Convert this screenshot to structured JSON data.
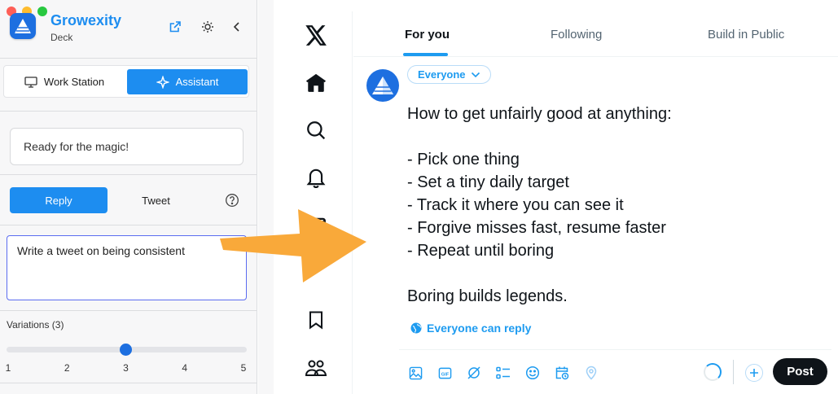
{
  "colors": {
    "brand_blue": "#1d8df0",
    "x_blue": "#1d9bf0",
    "arrow_orange": "#f9a93a",
    "post_button": "#0f1419"
  },
  "extension": {
    "app_name": "Growexity",
    "app_subtitle": "Deck",
    "header_icons": [
      "external-link-icon",
      "sun-icon",
      "chevron-left-icon"
    ],
    "mode_tabs": [
      {
        "label": "Work Station",
        "icon": "monitor-icon",
        "active": false
      },
      {
        "label": "Assistant",
        "icon": "sparkle-icon",
        "active": true
      }
    ],
    "status_box": "Ready for the magic!",
    "compose_tabs": [
      {
        "label": "Reply",
        "active": true
      },
      {
        "label": "Tweet",
        "active": false
      }
    ],
    "prompt_value": "Write a tweet on being consistent",
    "variations": {
      "label": "Variations (3)",
      "value": 3,
      "ticks": [
        "1",
        "2",
        "3",
        "4",
        "5"
      ]
    }
  },
  "x_nav": {
    "items": [
      "x-logo-icon",
      "home-icon",
      "search-icon",
      "bell-icon",
      "bookmark-icon",
      "communities-icon"
    ]
  },
  "x_main": {
    "tabs": [
      {
        "label": "For you",
        "active": true
      },
      {
        "label": "Following",
        "active": false
      },
      {
        "label": "Build in Public",
        "active": false
      }
    ],
    "audience": "Everyone",
    "tweet_text": "How to get unfairly good at anything:\n\n- Pick one thing\n- Set a tiny daily target\n- Track it where you can see it\n- Forgive misses fast, resume faster\n- Repeat until boring\n\nBoring builds legends.",
    "reply_permission": "Everyone can reply",
    "toolbar": [
      "image-icon",
      "gif-icon",
      "grok-icon",
      "poll-icon",
      "emoji-icon",
      "schedule-icon",
      "location-icon"
    ],
    "post_label": "Post"
  }
}
